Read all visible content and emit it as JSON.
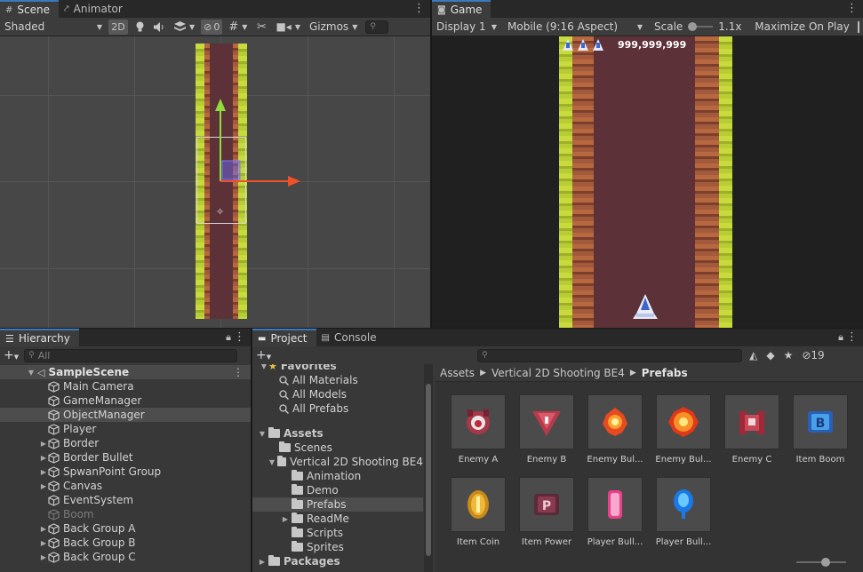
{
  "scene_tabs": {
    "scene": "Scene",
    "animator": "Animator"
  },
  "scene_toolbar": {
    "draw_mode": "Shaded",
    "mode_2d": "2D",
    "hidden_count": "0",
    "gizmos": "Gizmos"
  },
  "game_tab": {
    "label": "Game"
  },
  "game_toolbar": {
    "display": "Display 1",
    "aspect": "Mobile (9:16 Aspect)",
    "scale_label": "Scale",
    "scale_value": "1.1x",
    "maximize": "Maximize On Play"
  },
  "game_hud": {
    "score": "999,999,999"
  },
  "hierarchy": {
    "tab": "Hierarchy",
    "search_placeholder": "All",
    "scene_name": "SampleScene",
    "items": [
      {
        "label": "Main Camera",
        "expandable": false
      },
      {
        "label": "GameManager",
        "expandable": false
      },
      {
        "label": "ObjectManager",
        "expandable": false
      },
      {
        "label": "Player",
        "expandable": false
      },
      {
        "label": "Border",
        "expandable": true
      },
      {
        "label": "Border Bullet",
        "expandable": true
      },
      {
        "label": "SpwanPoint Group",
        "expandable": true
      },
      {
        "label": "Canvas",
        "expandable": true
      },
      {
        "label": "EventSystem",
        "expandable": false
      },
      {
        "label": "Boom",
        "expandable": false
      },
      {
        "label": "Back Group A",
        "expandable": true
      },
      {
        "label": "Back Group B",
        "expandable": true
      },
      {
        "label": "Back Group C",
        "expandable": true
      }
    ]
  },
  "project": {
    "tab": "Project",
    "console_tab": "Console",
    "hidden_count": "19",
    "favorites": "Favorites",
    "fav_items": [
      "All Materials",
      "All Models",
      "All Prefabs"
    ],
    "assets_root": "Assets",
    "folders": [
      {
        "label": "Scenes",
        "level": 1,
        "expand": ""
      },
      {
        "label": "Vertical 2D Shooting BE4",
        "level": 1,
        "expand": "▼"
      },
      {
        "label": "Animation",
        "level": 2,
        "expand": ""
      },
      {
        "label": "Demo",
        "level": 2,
        "expand": ""
      },
      {
        "label": "Prefabs",
        "level": 2,
        "expand": ""
      },
      {
        "label": "ReadMe",
        "level": 2,
        "expand": "▶"
      },
      {
        "label": "Scripts",
        "level": 2,
        "expand": ""
      },
      {
        "label": "Sprites",
        "level": 2,
        "expand": ""
      }
    ],
    "packages": "Packages",
    "breadcrumb": [
      "Assets",
      "Vertical 2D Shooting BE4",
      "Prefabs"
    ],
    "assets": [
      {
        "label": "Enemy A",
        "icon": "enemy-a-icon"
      },
      {
        "label": "Enemy B",
        "icon": "enemy-b-icon"
      },
      {
        "label": "Enemy Bul...",
        "icon": "enemy-bullet-a-icon"
      },
      {
        "label": "Enemy Bul...",
        "icon": "enemy-bullet-b-icon"
      },
      {
        "label": "Enemy C",
        "icon": "enemy-c-icon"
      },
      {
        "label": "Item Boom",
        "icon": "item-boom-icon"
      },
      {
        "label": "Item Coin",
        "icon": "item-coin-icon"
      },
      {
        "label": "Item Power",
        "icon": "item-power-icon"
      },
      {
        "label": "Player Bull...",
        "icon": "player-bullet-a-icon"
      },
      {
        "label": "Player Bull...",
        "icon": "player-bullet-b-icon"
      }
    ]
  },
  "colors": {
    "accent": "#3a79bb",
    "grass": "#b8cc34",
    "dirt": "#a35a3c",
    "lane": "#5c3238"
  }
}
